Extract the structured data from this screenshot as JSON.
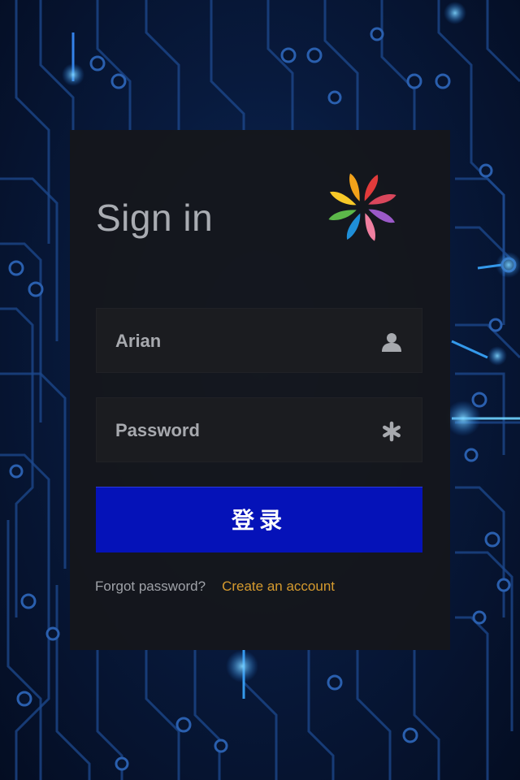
{
  "login": {
    "title": "Sign in",
    "username_value": "Arian",
    "password_placeholder": "Password",
    "submit_label": "登录",
    "forgot_label": "Forgot password?",
    "create_label": "Create an account"
  },
  "icons": {
    "logo": "pinwheel-logo",
    "username": "user-icon",
    "password": "asterisk-icon"
  },
  "colors": {
    "submit_button": "#0512b8",
    "create_link": "#d59a2e",
    "panel": "#16171b",
    "field": "#1b1c20"
  }
}
